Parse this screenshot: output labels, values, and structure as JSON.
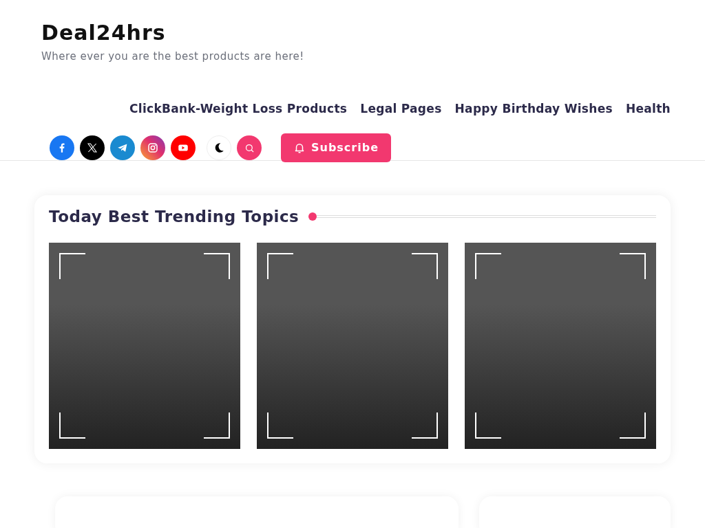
{
  "site": {
    "title": "Deal24hrs",
    "tagline": "Where ever you are the best products are here!"
  },
  "nav": [
    {
      "label": "ClickBank-Weight Loss Products"
    },
    {
      "label": "Legal Pages"
    },
    {
      "label": "Happy Birthday Wishes"
    },
    {
      "label": "Health"
    }
  ],
  "social": [
    {
      "kind": "facebook"
    },
    {
      "kind": "x"
    },
    {
      "kind": "telegram"
    },
    {
      "kind": "instagram"
    },
    {
      "kind": "youtube"
    }
  ],
  "tools": [
    {
      "kind": "theme"
    },
    {
      "kind": "search"
    }
  ],
  "subscribe": {
    "label": "Subscribe"
  },
  "trending": {
    "title": "Today Best Trending Topics"
  },
  "lower_cards": [
    {
      "kind": "wide"
    },
    {
      "kind": "narrow"
    }
  ]
}
